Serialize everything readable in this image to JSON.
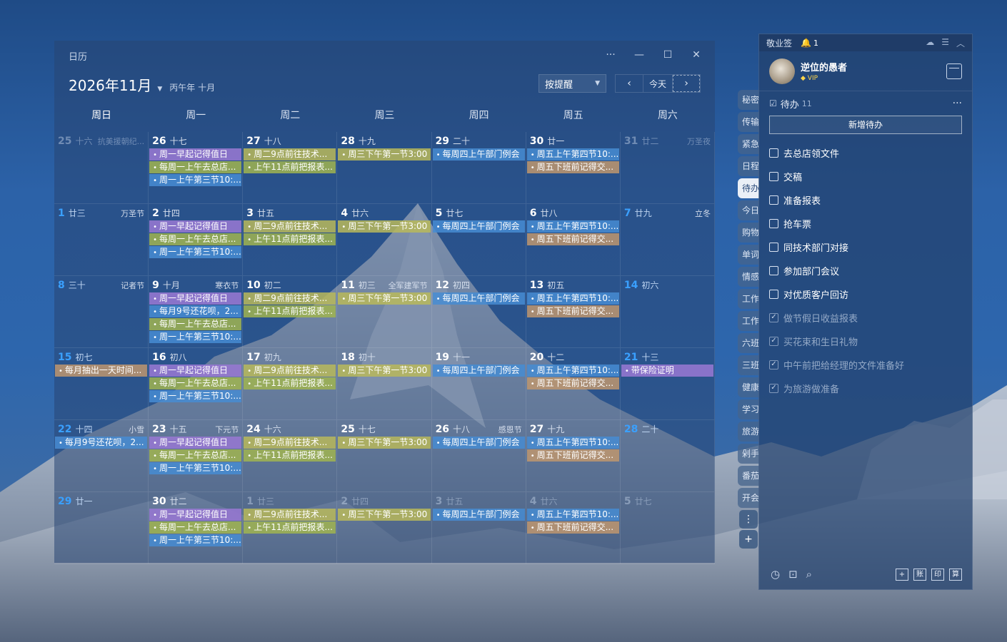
{
  "calendar": {
    "app_title": "日历",
    "month_title": "2026年11月",
    "lunar_subtitle": "丙午年 十月",
    "remind_label": "按提醒",
    "today_label": "今天",
    "weekdays": [
      "周日",
      "周一",
      "周二",
      "周三",
      "周四",
      "周五",
      "周六"
    ],
    "rows": [
      [
        {
          "num": "25",
          "lunar": "十六",
          "fest": "抗美援朝纪...",
          "dim": true,
          "events": []
        },
        {
          "num": "26",
          "lunar": "十七",
          "fest": "",
          "dim": false,
          "events": [
            {
              "text": "周一早起记得值日",
              "color": "purple"
            },
            {
              "text": "每周一上午去总店...",
              "color": "olive"
            },
            {
              "text": "周一上午第三节10:...",
              "color": "blue"
            }
          ]
        },
        {
          "num": "27",
          "lunar": "十八",
          "fest": "",
          "dim": false,
          "events": [
            {
              "text": "周二9点前往技术...",
              "color": "yellow"
            },
            {
              "text": "上午11点前把报表...",
              "color": "olive"
            }
          ]
        },
        {
          "num": "28",
          "lunar": "十九",
          "fest": "",
          "dim": false,
          "events": [
            {
              "text": "周三下午第一节3:00",
              "color": "yellow"
            }
          ]
        },
        {
          "num": "29",
          "lunar": "二十",
          "fest": "",
          "dim": false,
          "events": [
            {
              "text": "每周四上午部门例会",
              "color": "blue"
            }
          ]
        },
        {
          "num": "30",
          "lunar": "廿一",
          "fest": "",
          "dim": false,
          "events": [
            {
              "text": "周五上午第四节10:...",
              "color": "blue"
            },
            {
              "text": "周五下班前记得交...",
              "color": "tan"
            }
          ]
        },
        {
          "num": "31",
          "lunar": "廿二",
          "fest": "万圣夜",
          "dim": true,
          "events": []
        }
      ],
      [
        {
          "num": "1",
          "lunar": "廿三",
          "fest": "万圣节",
          "dim": false,
          "weekend": true,
          "events": []
        },
        {
          "num": "2",
          "lunar": "廿四",
          "fest": "",
          "dim": false,
          "events": [
            {
              "text": "周一早起记得值日",
              "color": "purple"
            },
            {
              "text": "每周一上午去总店...",
              "color": "olive"
            },
            {
              "text": "周一上午第三节10:...",
              "color": "blue"
            }
          ]
        },
        {
          "num": "3",
          "lunar": "廿五",
          "fest": "",
          "dim": false,
          "events": [
            {
              "text": "周二9点前往技术...",
              "color": "yellow"
            },
            {
              "text": "上午11点前把报表...",
              "color": "olive"
            }
          ]
        },
        {
          "num": "4",
          "lunar": "廿六",
          "fest": "",
          "dim": false,
          "events": [
            {
              "text": "周三下午第一节3:00",
              "color": "yellow"
            }
          ]
        },
        {
          "num": "5",
          "lunar": "廿七",
          "fest": "",
          "dim": false,
          "events": [
            {
              "text": "每周四上午部门例会",
              "color": "blue"
            }
          ]
        },
        {
          "num": "6",
          "lunar": "廿八",
          "fest": "",
          "dim": false,
          "events": [
            {
              "text": "周五上午第四节10:...",
              "color": "blue"
            },
            {
              "text": "周五下班前记得交...",
              "color": "tan"
            }
          ]
        },
        {
          "num": "7",
          "lunar": "廿九",
          "fest": "立冬",
          "dim": false,
          "weekend": true,
          "events": []
        }
      ],
      [
        {
          "num": "8",
          "lunar": "三十",
          "fest": "记者节",
          "dim": false,
          "weekend": true,
          "events": []
        },
        {
          "num": "9",
          "lunar": "十月",
          "fest": "寒衣节",
          "dim": false,
          "events": [
            {
              "text": "周一早起记得值日",
              "color": "purple"
            },
            {
              "text": "每月9号还花呗，2...",
              "color": "blue"
            },
            {
              "text": "每周一上午去总店...",
              "color": "olive"
            },
            {
              "text": "周一上午第三节10:...",
              "color": "blue"
            }
          ]
        },
        {
          "num": "10",
          "lunar": "初二",
          "fest": "",
          "dim": false,
          "events": [
            {
              "text": "周二9点前往技术...",
              "color": "yellow"
            },
            {
              "text": "上午11点前把报表...",
              "color": "olive"
            }
          ]
        },
        {
          "num": "11",
          "lunar": "初三",
          "fest": "全军建军节",
          "dim": false,
          "events": [
            {
              "text": "周三下午第一节3:00",
              "color": "yellow"
            }
          ]
        },
        {
          "num": "12",
          "lunar": "初四",
          "fest": "",
          "dim": false,
          "events": [
            {
              "text": "每周四上午部门例会",
              "color": "blue"
            }
          ]
        },
        {
          "num": "13",
          "lunar": "初五",
          "fest": "",
          "dim": false,
          "events": [
            {
              "text": "周五上午第四节10:...",
              "color": "blue"
            },
            {
              "text": "周五下班前记得交...",
              "color": "tan"
            }
          ]
        },
        {
          "num": "14",
          "lunar": "初六",
          "fest": "",
          "dim": false,
          "weekend": true,
          "events": []
        }
      ],
      [
        {
          "num": "15",
          "lunar": "初七",
          "fest": "",
          "dim": false,
          "weekend": true,
          "events": [
            {
              "text": "每月抽出一天时间...",
              "color": "tan"
            }
          ]
        },
        {
          "num": "16",
          "lunar": "初八",
          "fest": "",
          "dim": false,
          "events": [
            {
              "text": "周一早起记得值日",
              "color": "purple"
            },
            {
              "text": "每周一上午去总店...",
              "color": "olive"
            },
            {
              "text": "周一上午第三节10:...",
              "color": "blue"
            }
          ]
        },
        {
          "num": "17",
          "lunar": "初九",
          "fest": "",
          "dim": false,
          "events": [
            {
              "text": "周二9点前往技术...",
              "color": "yellow"
            },
            {
              "text": "上午11点前把报表...",
              "color": "olive"
            }
          ]
        },
        {
          "num": "18",
          "lunar": "初十",
          "fest": "",
          "dim": false,
          "events": [
            {
              "text": "周三下午第一节3:00",
              "color": "yellow"
            }
          ]
        },
        {
          "num": "19",
          "lunar": "十一",
          "fest": "",
          "dim": false,
          "events": [
            {
              "text": "每周四上午部门例会",
              "color": "blue"
            }
          ]
        },
        {
          "num": "20",
          "lunar": "十二",
          "fest": "",
          "dim": false,
          "events": [
            {
              "text": "周五上午第四节10:...",
              "color": "blue"
            },
            {
              "text": "周五下班前记得交...",
              "color": "tan"
            }
          ]
        },
        {
          "num": "21",
          "lunar": "十三",
          "fest": "",
          "dim": false,
          "weekend": true,
          "events": [
            {
              "text": "带保险证明",
              "color": "purple"
            }
          ]
        }
      ],
      [
        {
          "num": "22",
          "lunar": "十四",
          "fest": "小雪",
          "dim": false,
          "weekend": true,
          "events": [
            {
              "text": "每月9号还花呗，2...",
              "color": "blue"
            }
          ]
        },
        {
          "num": "23",
          "lunar": "十五",
          "fest": "下元节",
          "dim": false,
          "events": [
            {
              "text": "周一早起记得值日",
              "color": "purple"
            },
            {
              "text": "每周一上午去总店...",
              "color": "olive"
            },
            {
              "text": "周一上午第三节10:...",
              "color": "blue"
            }
          ]
        },
        {
          "num": "24",
          "lunar": "十六",
          "fest": "",
          "dim": false,
          "events": [
            {
              "text": "周二9点前往技术...",
              "color": "yellow"
            },
            {
              "text": "上午11点前把报表...",
              "color": "olive"
            }
          ]
        },
        {
          "num": "25",
          "lunar": "十七",
          "fest": "",
          "dim": false,
          "events": [
            {
              "text": "周三下午第一节3:00",
              "color": "yellow"
            }
          ]
        },
        {
          "num": "26",
          "lunar": "十八",
          "fest": "感恩节",
          "dim": false,
          "events": [
            {
              "text": "每周四上午部门例会",
              "color": "blue"
            }
          ]
        },
        {
          "num": "27",
          "lunar": "十九",
          "fest": "",
          "dim": false,
          "events": [
            {
              "text": "周五上午第四节10:...",
              "color": "blue"
            },
            {
              "text": "周五下班前记得交...",
              "color": "tan"
            }
          ]
        },
        {
          "num": "28",
          "lunar": "二十",
          "fest": "",
          "dim": false,
          "weekend": true,
          "events": []
        }
      ],
      [
        {
          "num": "29",
          "lunar": "廿一",
          "fest": "",
          "dim": false,
          "weekend": true,
          "events": []
        },
        {
          "num": "30",
          "lunar": "廿二",
          "fest": "",
          "dim": false,
          "events": [
            {
              "text": "周一早起记得值日",
              "color": "purple"
            },
            {
              "text": "每周一上午去总店...",
              "color": "olive"
            },
            {
              "text": "周一上午第三节10:...",
              "color": "blue"
            }
          ]
        },
        {
          "num": "1",
          "lunar": "廿三",
          "fest": "",
          "dim": true,
          "events": [
            {
              "text": "周二9点前往技术...",
              "color": "yellow"
            },
            {
              "text": "上午11点前把报表...",
              "color": "olive"
            }
          ]
        },
        {
          "num": "2",
          "lunar": "廿四",
          "fest": "",
          "dim": true,
          "events": [
            {
              "text": "周三下午第一节3:00",
              "color": "yellow"
            }
          ]
        },
        {
          "num": "3",
          "lunar": "廿五",
          "fest": "",
          "dim": true,
          "events": [
            {
              "text": "每周四上午部门例会",
              "color": "blue"
            }
          ]
        },
        {
          "num": "4",
          "lunar": "廿六",
          "fest": "",
          "dim": true,
          "events": [
            {
              "text": "周五上午第四节10:...",
              "color": "blue"
            },
            {
              "text": "周五下班前记得交...",
              "color": "tan"
            }
          ]
        },
        {
          "num": "5",
          "lunar": "廿七",
          "fest": "",
          "dim": true,
          "events": []
        }
      ]
    ]
  },
  "side_tabs": [
    "秘密",
    "传输",
    "紧急",
    "日程",
    "待办",
    "今日",
    "购物",
    "单词",
    "情感",
    "工作",
    "工作",
    "六班",
    "三班",
    "健康",
    "学习",
    "旅游",
    "剁手",
    "番茄",
    "开会"
  ],
  "side_tab_active_index": 4,
  "notes": {
    "app_name": "敬业签",
    "bell_count": "1",
    "username": "逆位的愚者",
    "vip_label": "VIP",
    "todo_title": "待办",
    "todo_count": "11",
    "add_label": "新增待办",
    "items": [
      {
        "text": "去总店领文件",
        "done": false
      },
      {
        "text": "交稿",
        "done": false
      },
      {
        "text": "准备报表",
        "done": false
      },
      {
        "text": "抢车票",
        "done": false
      },
      {
        "text": "同技术部门对接",
        "done": false
      },
      {
        "text": "参加部门会议",
        "done": false
      },
      {
        "text": "对优质客户回访",
        "done": false
      },
      {
        "text": "做节假日收益报表",
        "done": true
      },
      {
        "text": "买花束和生日礼物",
        "done": true
      },
      {
        "text": "中午前把给经理的文件准备好",
        "done": true
      },
      {
        "text": "为旅游做准备",
        "done": true
      }
    ],
    "bottom_boxes": [
      "+",
      "账",
      "印",
      "算"
    ]
  }
}
